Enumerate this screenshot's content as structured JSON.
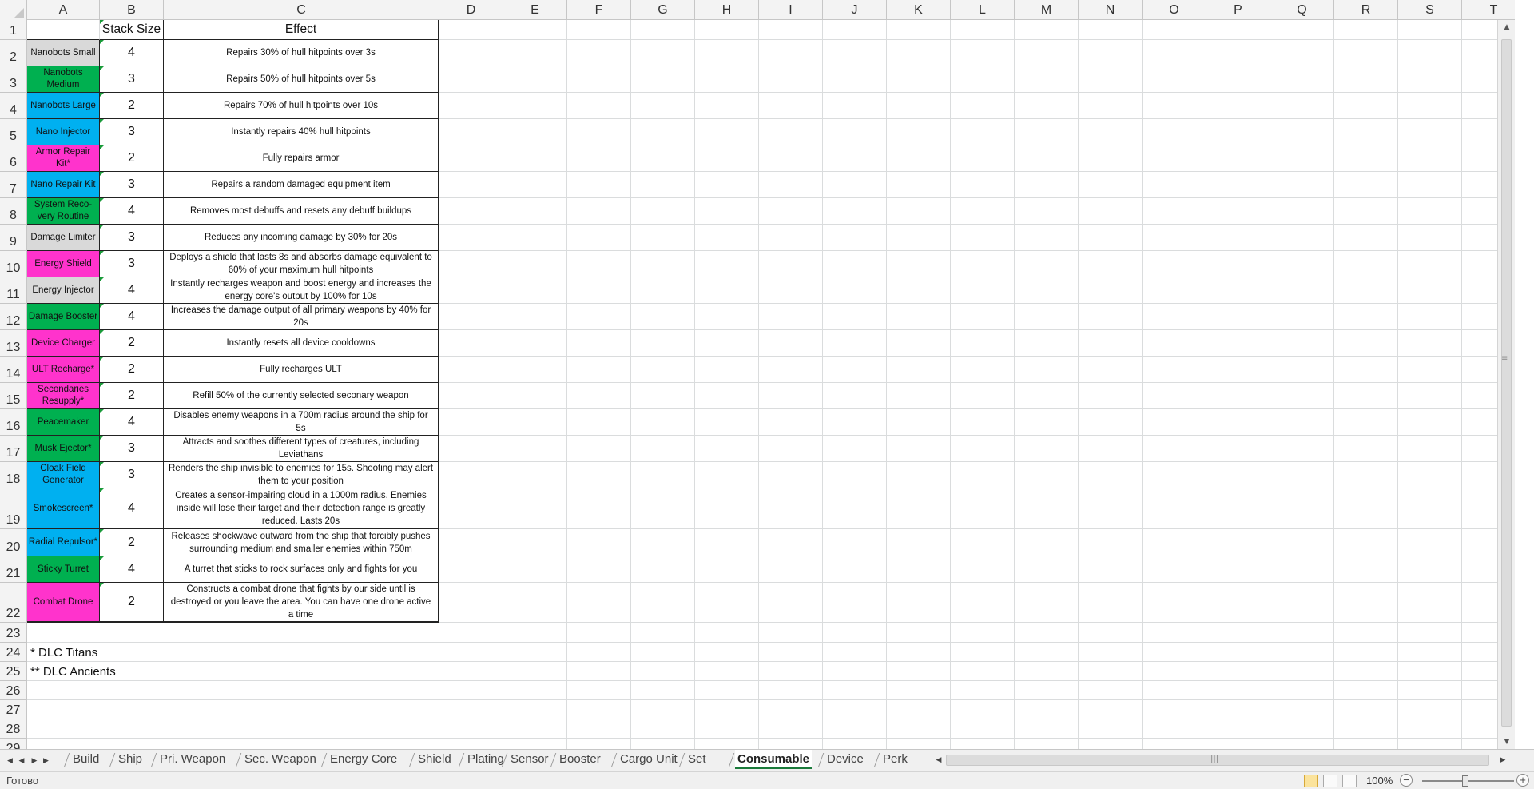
{
  "sheet": {
    "columns": [
      "A",
      "B",
      "C",
      "D",
      "E",
      "F",
      "G",
      "H",
      "I",
      "J",
      "K",
      "L",
      "M",
      "N",
      "O",
      "P",
      "Q",
      "R",
      "S",
      "T"
    ],
    "header": {
      "row": "1",
      "b": "Stack Size",
      "c": "Effect"
    },
    "colors": {
      "gray": "#d9d9d9",
      "green": "#00b050",
      "blue": "#00b0f0",
      "pink": "#ff33cc"
    },
    "items": [
      {
        "row": "2",
        "name": "Nanobots Small",
        "color": "gray",
        "stack": "4",
        "effect": "Repairs 30% of hull hitpoints over 3s"
      },
      {
        "row": "3",
        "name": "Nanobots Medium",
        "color": "green",
        "stack": "3",
        "effect": "Repairs 50% of hull hitpoints over 5s"
      },
      {
        "row": "4",
        "name": "Nanobots Large",
        "color": "blue",
        "stack": "2",
        "effect": "Repairs 70% of hull hitpoints over 10s"
      },
      {
        "row": "5",
        "name": "Nano Injector",
        "color": "blue",
        "stack": "3",
        "effect": "Instantly repairs 40% hull hitpoints"
      },
      {
        "row": "6",
        "name": "Armor Repair Kit*",
        "color": "pink",
        "stack": "2",
        "effect": "Fully repairs armor"
      },
      {
        "row": "7",
        "name": "Nano Repair Kit",
        "color": "blue",
        "stack": "3",
        "effect": "Repairs a random damaged equipment item"
      },
      {
        "row": "8",
        "name": "System Reco-very Routine",
        "color": "green",
        "stack": "4",
        "effect": "Removes most debuffs and resets any debuff buildups"
      },
      {
        "row": "9",
        "name": "Damage Limiter",
        "color": "gray",
        "stack": "3",
        "effect": "Reduces any incoming damage by 30% for 20s"
      },
      {
        "row": "10",
        "name": "Energy Shield",
        "color": "pink",
        "stack": "3",
        "effect": "Deploys a shield that lasts 8s and absorbs damage equivalent to 60% of your maximum hull hitpoints"
      },
      {
        "row": "11",
        "name": "Energy Injector",
        "color": "gray",
        "stack": "4",
        "effect": "Instantly recharges weapon and boost energy and increases the energy core's output by 100% for 10s"
      },
      {
        "row": "12",
        "name": "Damage Booster",
        "color": "green",
        "stack": "4",
        "effect": "Increases the damage output of all primary weapons by 40% for 20s"
      },
      {
        "row": "13",
        "name": "Device Charger",
        "color": "pink",
        "stack": "2",
        "effect": "Instantly resets all device cooldowns"
      },
      {
        "row": "14",
        "name": "ULT Recharge*",
        "color": "pink",
        "stack": "2",
        "effect": "Fully recharges ULT"
      },
      {
        "row": "15",
        "name": "Secondaries Resupply*",
        "color": "pink",
        "stack": "2",
        "effect": "Refill 50% of the currently selected seconary weapon"
      },
      {
        "row": "16",
        "name": "Peacemaker",
        "color": "green",
        "stack": "4",
        "effect": "Disables enemy weapons in a 700m radius around the ship for 5s"
      },
      {
        "row": "17",
        "name": "Musk Ejector*",
        "color": "green",
        "stack": "3",
        "effect": "Attracts and soothes different types of creatures, including Leviathans"
      },
      {
        "row": "18",
        "name": "Cloak Field Generator",
        "color": "blue",
        "stack": "3",
        "effect": "Renders the ship invisible to enemies for 15s. Shooting may alert them to your position"
      },
      {
        "row": "19",
        "name": "Smokescreen*",
        "color": "blue",
        "stack": "4",
        "effect": "Creates a sensor-impairing cloud in a 1000m radius. Enemies inside will lose their target and their detection range is greatly reduced. Lasts 20s"
      },
      {
        "row": "20",
        "name": "Radial Repulsor*",
        "color": "blue",
        "stack": "2",
        "effect": "Releases shockwave outward from the ship that forcibly pushes surrounding medium and smaller enemies within 750m"
      },
      {
        "row": "21",
        "name": "Sticky Turret",
        "color": "green",
        "stack": "4",
        "effect": "A turret that sticks to rock surfaces only and fights for you"
      },
      {
        "row": "22",
        "name": "Combat Drone",
        "color": "pink",
        "stack": "2",
        "effect": "Constructs a combat drone that fights by our side until is destroyed or you leave the area. You can have one drone active a time"
      }
    ],
    "notes": [
      {
        "row": "24",
        "text": "* DLC Titans"
      },
      {
        "row": "25",
        "text": "** DLC Ancients"
      }
    ],
    "empty_rows": [
      "23",
      "26",
      "27",
      "28",
      "29"
    ]
  },
  "tabs": [
    "Build",
    "Ship",
    "Pri. Weapon",
    "Sec. Weapon",
    "Energy Core",
    "Shield",
    "Plating",
    "Sensor",
    "Booster",
    "Cargo Unit",
    "Set",
    "Consumable",
    "Device",
    "Perk"
  ],
  "active_tab": "Consumable",
  "status": {
    "ready": "Готово",
    "zoom": "100%"
  }
}
